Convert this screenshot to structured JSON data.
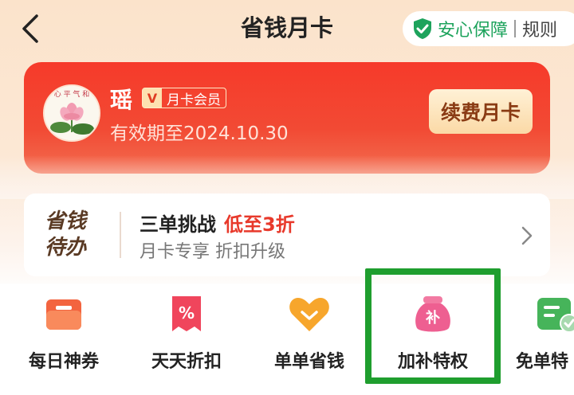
{
  "header": {
    "title": "省钱月卡",
    "guarantee_label": "安心保障",
    "rules_label": "规则"
  },
  "member": {
    "username": "瑶",
    "badge_v": "V",
    "badge_label": "月卡会员",
    "expiry": "有效期至2024.10.30",
    "renew_label": "续费月卡"
  },
  "todo": {
    "logo_line1": "省钱",
    "logo_line2": "待办",
    "title": "三单挑战",
    "highlight": "低至3折",
    "subtitle": "月卡专享 折扣升级"
  },
  "privileges": [
    {
      "label": "每日神券",
      "icon": "coupon-icon"
    },
    {
      "label": "天天折扣",
      "icon": "discount-icon"
    },
    {
      "label": "单单省钱",
      "icon": "heart-save-icon"
    },
    {
      "label": "加补特权",
      "icon": "subsidy-bag-icon",
      "icon_char": "补"
    },
    {
      "label": "免单特",
      "icon": "free-order-icon"
    }
  ],
  "colors": {
    "brand_red": "#f63a2a",
    "guarantee_green": "#1da35c",
    "highlight_border": "#1f9e2e",
    "renew_text": "#8a3b14"
  }
}
